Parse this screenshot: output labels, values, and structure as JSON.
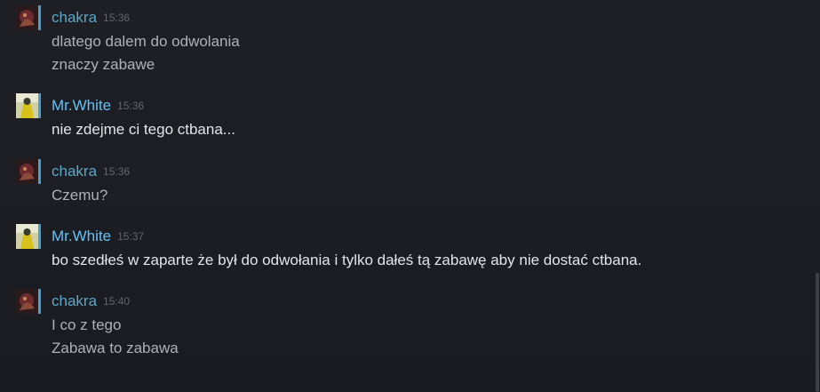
{
  "colors": {
    "chakra_name": "#5aa7c8",
    "white_name": "#66c0f4",
    "chakra_text": "#aeb1b6",
    "white_text": "#e3e4e6",
    "timestamp": "#62656c",
    "avatar_border": "#4a9fd1"
  },
  "messages": [
    {
      "author": "chakra",
      "time": "15:36",
      "avatar_icon": "chakra-avatar-icon",
      "lines": [
        "dlatego dalem do odwolania",
        "znaczy zabawe"
      ]
    },
    {
      "author": "Mr.White",
      "time": "15:36",
      "avatar_icon": "mr-white-avatar-icon",
      "lines": [
        "nie zdejme ci tego ctbana..."
      ]
    },
    {
      "author": "chakra",
      "time": "15:36",
      "avatar_icon": "chakra-avatar-icon",
      "lines": [
        "Czemu?"
      ]
    },
    {
      "author": "Mr.White",
      "time": "15:37",
      "avatar_icon": "mr-white-avatar-icon",
      "lines": [
        "bo szedłeś w zaparte że był do odwołania i tylko dałeś tą zabawę aby nie dostać ctbana."
      ]
    },
    {
      "author": "chakra",
      "time": "15:40",
      "avatar_icon": "chakra-avatar-icon",
      "lines": [
        "I co z tego",
        "Zabawa to zabawa"
      ]
    }
  ]
}
